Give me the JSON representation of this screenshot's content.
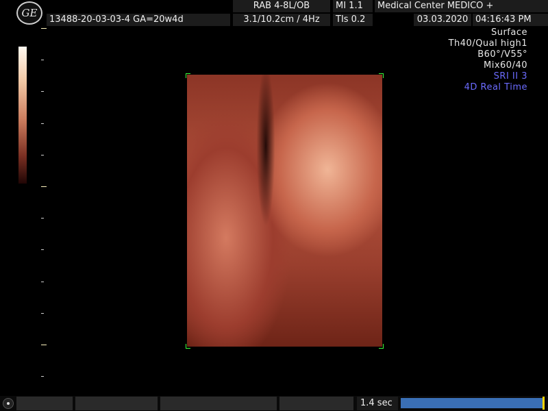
{
  "header": {
    "logo_text": "GE",
    "probe": "RAB 4-8L/OB",
    "mi": "MI  1.1",
    "institution": "Medical Center MEDICO +",
    "patient": "13488-20-03-03-4  GA=20w4d",
    "depth_freq": "3.1/10.2cm /  4Hz",
    "tis": "TIs  0.2",
    "date": "03.03.2020",
    "time": "04:16:43 PM"
  },
  "render_params": [
    {
      "text": "Surface",
      "color": "#e8e8e8"
    },
    {
      "text": "Th40/Qual high1",
      "color": "#e8e8e8"
    },
    {
      "text": "B60°/V55°",
      "color": "#e8e8e8"
    },
    {
      "text": "Mix60/40",
      "color": "#e8e8e8"
    },
    {
      "text": "SRI II 3",
      "color": "#6b6bff"
    },
    {
      "text": "4D Real Time",
      "color": "#6b6bff"
    }
  ],
  "cine": {
    "duration_label": "1.4 sec",
    "fill_color": "#3a6fb5",
    "marker_color": "#ffd400"
  },
  "colors": {
    "frame_corner": "#3cff3c",
    "render_tint": "#c7664c"
  }
}
